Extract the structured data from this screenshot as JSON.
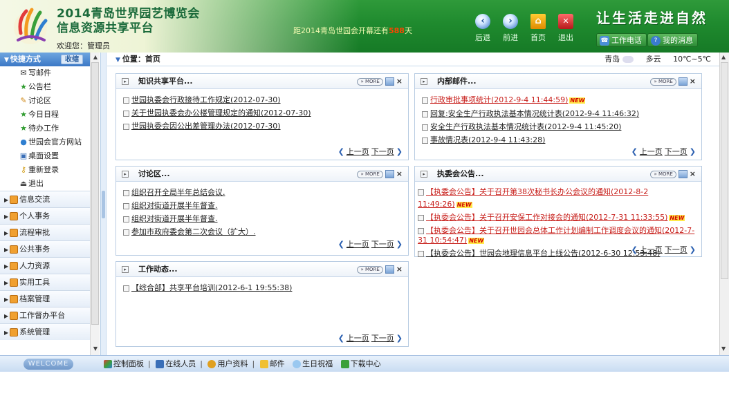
{
  "header": {
    "title_line1": "2014青岛世界园艺博览会",
    "title_line2": "信息资源共享平台",
    "welcome": "欢迎您：管理员",
    "countdown_prefix": "距2014青岛世园会开幕还有",
    "countdown_days": "588",
    "countdown_suffix": "天",
    "nav": [
      {
        "label": "后退",
        "icon": "back-icon"
      },
      {
        "label": "前进",
        "icon": "forward-icon"
      },
      {
        "label": "首页",
        "icon": "home-icon"
      },
      {
        "label": "退出",
        "icon": "exit-icon"
      }
    ],
    "slogan": "让生活走进自然",
    "work_phone": "工作电话",
    "my_messages": "我的消息"
  },
  "sidebar": {
    "header": "快捷方式",
    "collapse": "收缩",
    "quick_items": [
      {
        "label": "写邮件",
        "icon": "mail-compose-icon"
      },
      {
        "label": "公告栏",
        "icon": "star-icon"
      },
      {
        "label": "讨论区",
        "icon": "pencil-icon"
      },
      {
        "label": "今日日程",
        "icon": "star-icon"
      },
      {
        "label": "待办工作",
        "icon": "star-icon"
      },
      {
        "label": "世园会官方网站",
        "icon": "globe-icon"
      },
      {
        "label": "桌面设置",
        "icon": "desktop-icon"
      },
      {
        "label": "重新登录",
        "icon": "key-icon"
      },
      {
        "label": "退出",
        "icon": "exit-icon"
      }
    ],
    "sections": [
      "信息交流",
      "个人事务",
      "流程审批",
      "公共事务",
      "人力资源",
      "实用工具",
      "档案管理",
      "工作督办平台",
      "系统管理"
    ]
  },
  "location": {
    "label": "位置：首页",
    "city": "青岛",
    "weather": "多云",
    "temp": "10℃~5℃"
  },
  "panels": {
    "knowledge": {
      "title": "知识共享平台...",
      "items": [
        {
          "text": "世园执委会行政接待工作规定(2012-07-30)"
        },
        {
          "text": "关于世园执委会办公楼管理规定的通知(2012-07-30)"
        },
        {
          "text": "世园执委会因公出差管理办法(2012-07-30)"
        }
      ]
    },
    "internal_mail": {
      "title": "内部邮件...",
      "items": [
        {
          "text": "行政审批事项统计(2012-9-4 11:44:59)",
          "new": "NEW",
          "red": true
        },
        {
          "text": "回复:安全生产行政执法基本情况统计表(2012-9-4 11:46:32)"
        },
        {
          "text": "安全生产行政执法基本情况统计表(2012-9-4 11:45:20)"
        },
        {
          "text": "事故情况表(2012-9-4 11:43:28)"
        }
      ]
    },
    "discussion": {
      "title": "讨论区...",
      "items": [
        {
          "text": "组织召开全局半年总结会议."
        },
        {
          "text": "组织对街道开展半年督查."
        },
        {
          "text": "组织对街道开展半年督查."
        },
        {
          "text": "参加市政府委会第二次会议（扩大）."
        }
      ]
    },
    "announcements": {
      "title": "执委会公告...",
      "items": [
        {
          "text": "【执委会公告】关于召开第38次秘书长办公会议的通知(2012-8-2 11:49:26)",
          "new": "NEW",
          "red": true
        },
        {
          "text": "【执委会公告】关于召开安保工作对接会的通知(2012-7-31 11:33:55)",
          "new": "NEW",
          "red": true
        },
        {
          "text": "【执委会公告】关于召开世园会总体工作计划编制工作调度会议的通知(2012-7-31 10:54:47)",
          "new": "NEW",
          "red": true
        },
        {
          "text": "【执委会公告】世园会地理信息平台上线公告(2012-6-30 12:53:48)"
        }
      ]
    },
    "work_updates": {
      "title": "工作动态...",
      "items": [
        {
          "text": "【综合部】共享平台培训(2012-6-1 19:55:38)"
        }
      ]
    },
    "more_label": "» MORE",
    "prev_label": "上一页",
    "next_label": "下一页"
  },
  "footer": {
    "welcome": "WELCOME",
    "links": [
      "控制面板",
      "在线人员",
      "用户资料",
      "邮件",
      "生日祝福",
      "下载中心"
    ]
  }
}
